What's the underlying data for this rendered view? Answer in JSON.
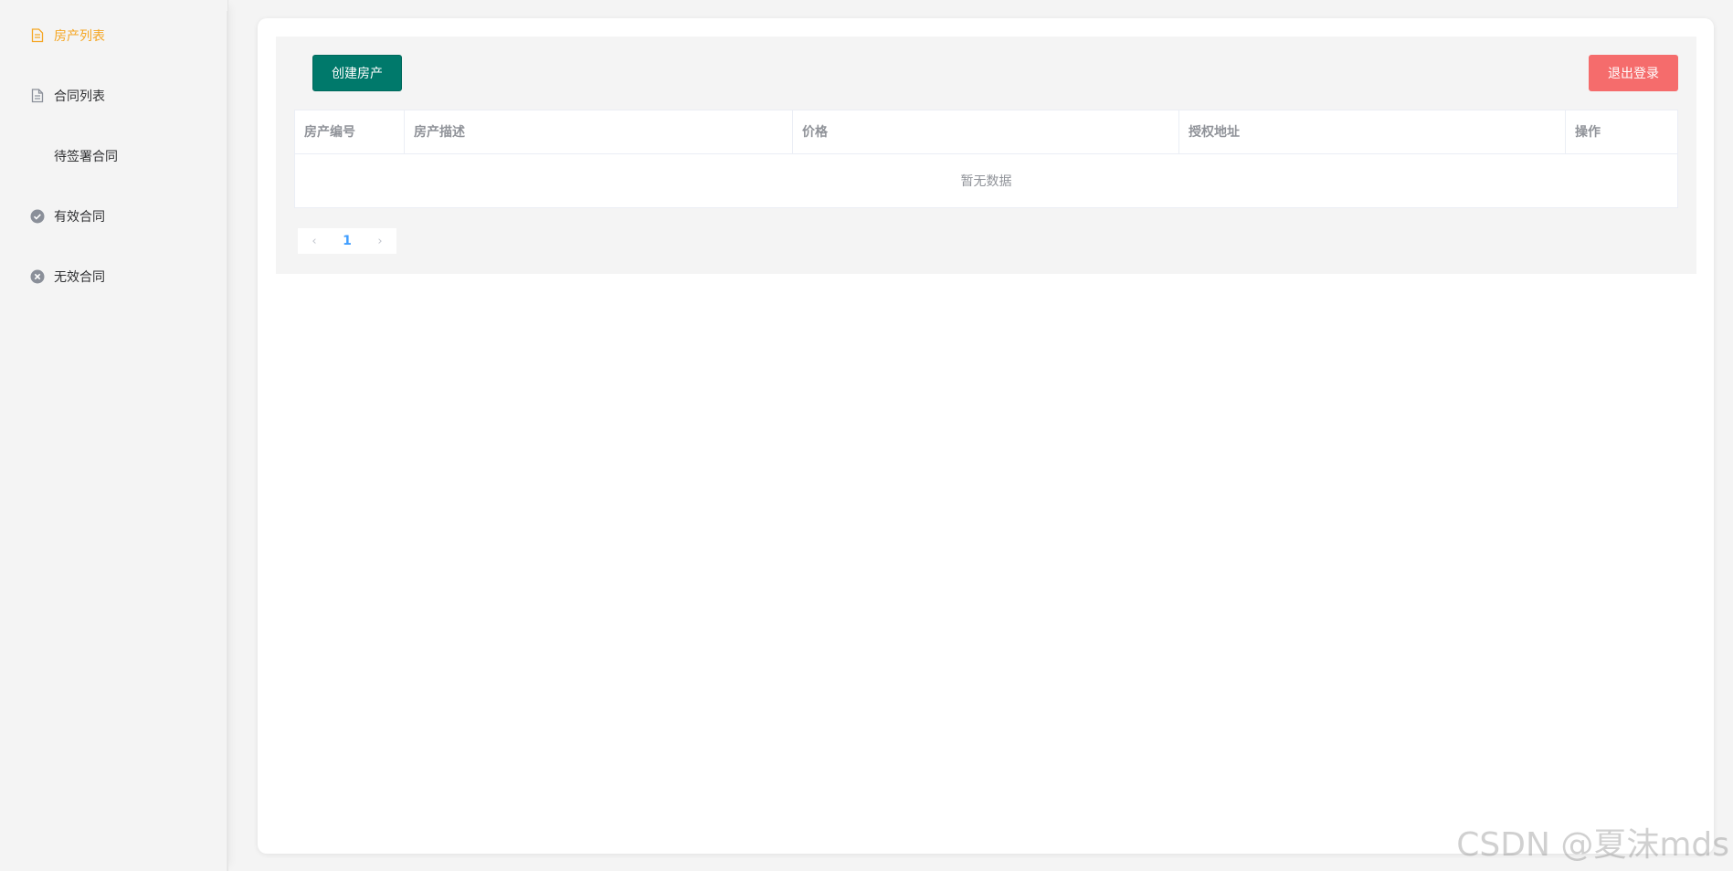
{
  "sidebar": {
    "items": [
      {
        "label": "房产列表",
        "icon": "document-icon",
        "active": true
      },
      {
        "label": "合同列表",
        "icon": "document-icon",
        "active": false
      },
      {
        "label": "待签署合同",
        "icon": "",
        "active": false
      },
      {
        "label": "有效合同",
        "icon": "check-circle-icon",
        "active": false
      },
      {
        "label": "无效合同",
        "icon": "close-circle-icon",
        "active": false
      }
    ]
  },
  "toolbar": {
    "create_label": "创建房产",
    "logout_label": "退出登录"
  },
  "table": {
    "columns": [
      "房产编号",
      "房产描述",
      "价格",
      "授权地址",
      "操作"
    ],
    "empty_text": "暂无数据"
  },
  "pagination": {
    "prev": "‹",
    "current": "1",
    "next": "›"
  },
  "watermark": "CSDN @夏沫mds",
  "colors": {
    "accent": "#f5a623",
    "create_button": "#00796b",
    "logout_button": "#f56c6c",
    "page_active": "#409eff"
  }
}
